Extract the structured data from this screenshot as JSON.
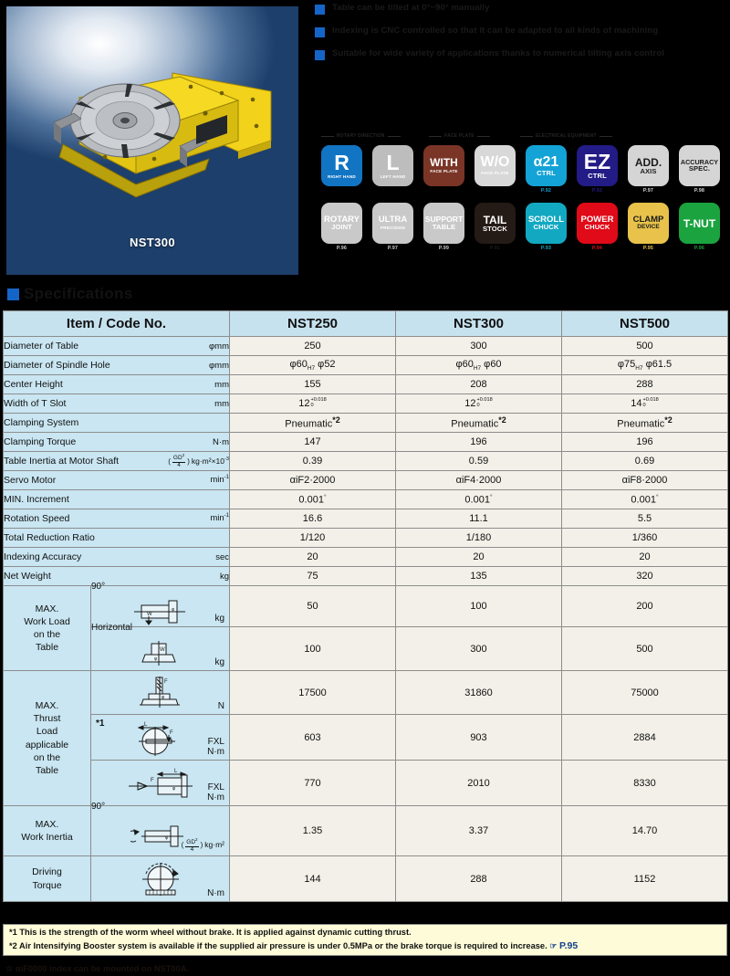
{
  "product": {
    "photo_label": "NST300"
  },
  "bullets": [
    "Table can be tilted at 0°~90° manually",
    "Indexing is CNC controlled so that it can be adapted to all kinds of machining",
    "Suitable for wide variety of applications thanks to numerical tilting axis control"
  ],
  "icon_group_headers": [
    "ROTARY DIRECTION",
    "FACE PLATE",
    "ELECTRICAL EQUIPMENT"
  ],
  "icons_row1": [
    {
      "big": "R",
      "small": "RIGHT HAND",
      "page": "",
      "bg": "#1275c4",
      "fg": "#ffffff"
    },
    {
      "big": "L",
      "small": "LEFT HAND",
      "page": "",
      "bg": "#bdbdbd",
      "fg": "#ffffff"
    },
    {
      "big": "WITH",
      "small": "FACE PLATE",
      "page": "",
      "bg": "#7a3526",
      "fg": "#ffffff"
    },
    {
      "big": "W/O",
      "small": "FACE PLATE",
      "page": "",
      "bg": "#d8d8d8",
      "fg": "#ffffff"
    },
    {
      "big": "α21",
      "small": "CTRL",
      "page": "P.92",
      "bg": "#13a3d6",
      "fg": "#ffffff"
    },
    {
      "big": "EZ",
      "small": "CTRL",
      "page": "P.93",
      "bg": "#231b86",
      "fg": "#ffffff"
    },
    {
      "big": "ADD.",
      "small": "AXIS",
      "page": "P.97",
      "bg": "#d5d5d5",
      "fg": "#1b1b1b"
    },
    {
      "big": "ACCURACY",
      "small": "SPEC.",
      "page": "P.98",
      "bg": "#d5d5d5",
      "fg": "#1b1b1b"
    }
  ],
  "icons_row2": [
    {
      "big": "ROTARY",
      "small": "JOINT",
      "page": "P.96",
      "bg": "#c9c9c9",
      "fg": "#ffffff"
    },
    {
      "big": "ULTRA",
      "small": "PRECISION",
      "page": "P.97",
      "bg": "#c9c9c9",
      "fg": "#ffffff"
    },
    {
      "big": "SUPPORT",
      "small": "TABLE",
      "page": "P.99",
      "bg": "#c9c9c9",
      "fg": "#ffffff"
    },
    {
      "big": "TAIL",
      "small": "STOCK",
      "page": "P.91",
      "bg": "#241a16",
      "fg": "#ffffff"
    },
    {
      "big": "SCROLL",
      "small": "CHUCK",
      "page": "P.93",
      "bg": "#13a8c2",
      "fg": "#ffffff"
    },
    {
      "big": "POWER",
      "small": "CHUCK",
      "page": "P.94",
      "bg": "#e00a18",
      "fg": "#ffffff"
    },
    {
      "big": "CLAMP",
      "small": "DEVICE",
      "page": "P.95",
      "bg": "#e8c24a",
      "fg": "#1b1b1b"
    },
    {
      "big": "T-NUT",
      "small": "",
      "page": "P.96",
      "bg": "#1aa33f",
      "fg": "#ffffff"
    }
  ],
  "section_title": "Specifications",
  "table": {
    "header": {
      "item": "Item / Code No.",
      "models": [
        "NST250",
        "NST300",
        "NST500"
      ]
    },
    "rows": [
      {
        "name": "Diameter of Table",
        "unit": "φmm",
        "values": [
          "250",
          "300",
          "500"
        ]
      },
      {
        "name": "Diameter of Spindle Hole",
        "unit": "φmm",
        "values": [
          "φ60H7  φ52",
          "φ60H7  φ60",
          "φ75H7  φ61.5"
        ]
      },
      {
        "name": "Center Height",
        "unit": "mm",
        "values": [
          "155",
          "208",
          "288"
        ]
      },
      {
        "name": "Width of T Slot",
        "unit": "mm",
        "values": [
          "12 +0.018 / 0",
          "12 +0.018 / 0",
          "14 +0.018 / 0"
        ]
      },
      {
        "name": "Clamping System",
        "unit": "",
        "values": [
          "Pneumatic*2",
          "Pneumatic*2",
          "Pneumatic*2"
        ]
      },
      {
        "name": "Clamping Torque",
        "unit": "N·m",
        "values": [
          "147",
          "196",
          "196"
        ]
      },
      {
        "name": "Table Inertia at Motor Shaft",
        "unit": "(GD²/4) kg·m²×10⁻³",
        "values": [
          "0.39",
          "0.59",
          "0.69"
        ]
      },
      {
        "name": "Servo Motor",
        "unit": "min⁻¹",
        "values": [
          "αiF2·2000",
          "αiF4·2000",
          "αiF8·2000"
        ]
      },
      {
        "name": "MIN. Increment",
        "unit": "",
        "values": [
          "0.001°",
          "0.001°",
          "0.001°"
        ]
      },
      {
        "name": "Rotation Speed",
        "unit": "min⁻¹",
        "values": [
          "16.6",
          "11.1",
          "5.5"
        ]
      },
      {
        "name": "Total Reduction Ratio",
        "unit": "",
        "values": [
          "1/120",
          "1/180",
          "1/360"
        ]
      },
      {
        "name": "Indexing Accuracy",
        "unit": "sec",
        "values": [
          "20",
          "20",
          "20"
        ]
      },
      {
        "name": "Net Weight",
        "unit": "kg",
        "values": [
          "75",
          "135",
          "320"
        ]
      }
    ],
    "groups": [
      {
        "label": "MAX.\nWork Load\non the\nTable",
        "subrows": [
          {
            "caption": "90°",
            "note": "",
            "unit": "kg",
            "values": [
              "50",
              "100",
              "200"
            ]
          },
          {
            "caption": "Horizontal",
            "note": "",
            "unit": "kg",
            "values": [
              "100",
              "300",
              "500"
            ]
          }
        ]
      },
      {
        "label": "MAX.\nThrust\nLoad\napplicable\non the\nTable",
        "subrows": [
          {
            "caption": "",
            "note": "",
            "unit": "N",
            "values": [
              "17500",
              "31860",
              "75000"
            ]
          },
          {
            "caption": "",
            "note": "*1",
            "unit": "FXL\nN·m",
            "values": [
              "603",
              "903",
              "2884"
            ]
          },
          {
            "caption": "",
            "note": "",
            "unit": "FXL\nN·m",
            "values": [
              "770",
              "2010",
              "8330"
            ]
          }
        ]
      },
      {
        "label": "MAX.\nWork Inertia",
        "subrows": [
          {
            "caption": "90°",
            "note": "",
            "unit": "(GD²/4) kg·m²",
            "values": [
              "1.35",
              "3.37",
              "14.70"
            ]
          }
        ]
      },
      {
        "label": "Driving\nTorque",
        "subrows": [
          {
            "caption": "",
            "note": "",
            "unit": "N·m",
            "values": [
              "144",
              "288",
              "1152"
            ]
          }
        ]
      }
    ]
  },
  "footnotes": {
    "n1": "*1 This is the strength of the worm wheel without brake. It is applied against dynamic cutting thrust.",
    "n2": "*2 Air Intensifying Booster system is available if the supplied air pressure is under 0.5MPa or the brake torque is required to increase.",
    "n2_page": "P.95",
    "cut": "☆ αiF0000 index can be mounted on NST00A."
  }
}
